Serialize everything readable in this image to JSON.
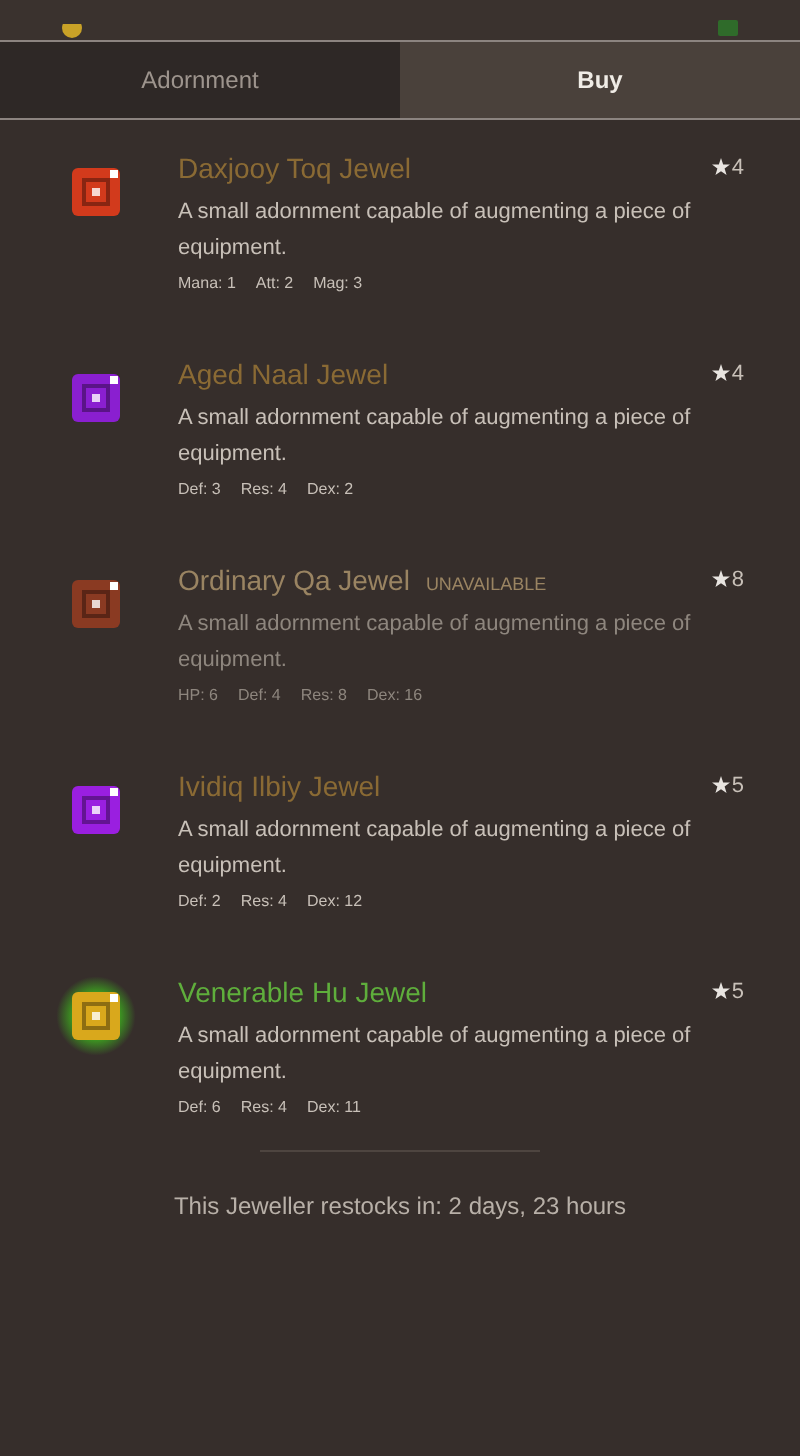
{
  "tabs": [
    {
      "label": "Adornment",
      "selected": false
    },
    {
      "label": "Buy",
      "selected": true
    }
  ],
  "items": [
    {
      "name": "Daxjooy Toq Jewel",
      "color": "#d23a1c",
      "glow": false,
      "disabled": false,
      "rank": "4",
      "description": "A small adornment capable of augmenting a piece of equipment.",
      "stats": [
        "Mana: 1",
        "Att: 2",
        "Mag: 3"
      ]
    },
    {
      "name": "Aged Naal Jewel",
      "color": "#8a1fd0",
      "glow": false,
      "disabled": false,
      "rank": "4",
      "description": "A small adornment capable of augmenting a piece of equipment.",
      "stats": [
        "Def: 3",
        "Res: 4",
        "Dex: 2"
      ]
    },
    {
      "name": "Ordinary Qa Jewel",
      "tag": "UNAVAILABLE",
      "color": "#8a3a22",
      "glow": false,
      "disabled": true,
      "rank": "8",
      "description": "A small adornment capable of augmenting a piece of equipment.",
      "stats": [
        "HP: 6",
        "Def: 4",
        "Res: 8",
        "Dex: 16"
      ]
    },
    {
      "name": "Ividiq Ilbiy Jewel",
      "color": "#9a1fe0",
      "glow": false,
      "disabled": false,
      "rank": "5",
      "description": "A small adornment capable of augmenting a piece of equipment.",
      "stats": [
        "Def: 2",
        "Res: 4",
        "Dex: 12"
      ]
    },
    {
      "name": "Venerable Hu Jewel",
      "color": "#d9a81c",
      "glow": true,
      "disabled": false,
      "rank": "5",
      "description": "A small adornment capable of augmenting a piece of equipment.",
      "stats": [
        "Def: 6",
        "Res: 4",
        "Dex: 11"
      ]
    }
  ],
  "restock": "This Jeweller restocks in: 2 days, 23 hours"
}
